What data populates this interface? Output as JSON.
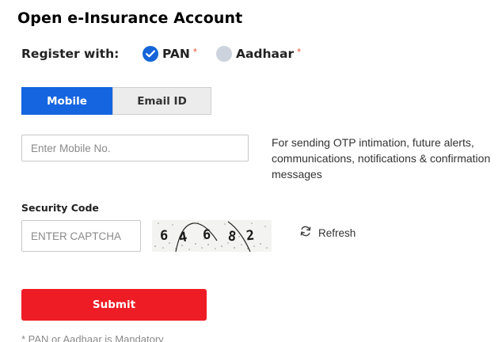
{
  "form": {
    "title": "Open e-Insurance Account",
    "register_label": "Register with:",
    "options": [
      {
        "label": "PAN",
        "required_mark": "*",
        "selected": true
      },
      {
        "label": "Aadhaar",
        "required_mark": "*",
        "selected": false
      }
    ],
    "tabs": [
      {
        "label": "Mobile",
        "active": true
      },
      {
        "label": "Email ID",
        "active": false
      }
    ],
    "mobile": {
      "placeholder": "Enter Mobile No.",
      "value": ""
    },
    "otp_note": "For sending OTP intimation, future alerts, communications, notifications & confirmation messages",
    "security": {
      "label": "Security Code",
      "placeholder": "ENTER CAPTCHA",
      "value": "",
      "captcha_text": "6 4 6 8 2",
      "refresh_label": "Refresh"
    },
    "submit_label": "Submit",
    "footnote": "* PAN or Aadhaar is Mandatory"
  },
  "colors": {
    "primary_blue": "#1565e0",
    "submit_red": "#ee1c25",
    "asterisk_orange": "#e8603c",
    "unchecked_grey": "#cdd3dc"
  },
  "icons": {
    "pan_radio": "check-circle-icon",
    "aadhaar_radio": "empty-circle-icon",
    "refresh": "refresh-icon"
  }
}
